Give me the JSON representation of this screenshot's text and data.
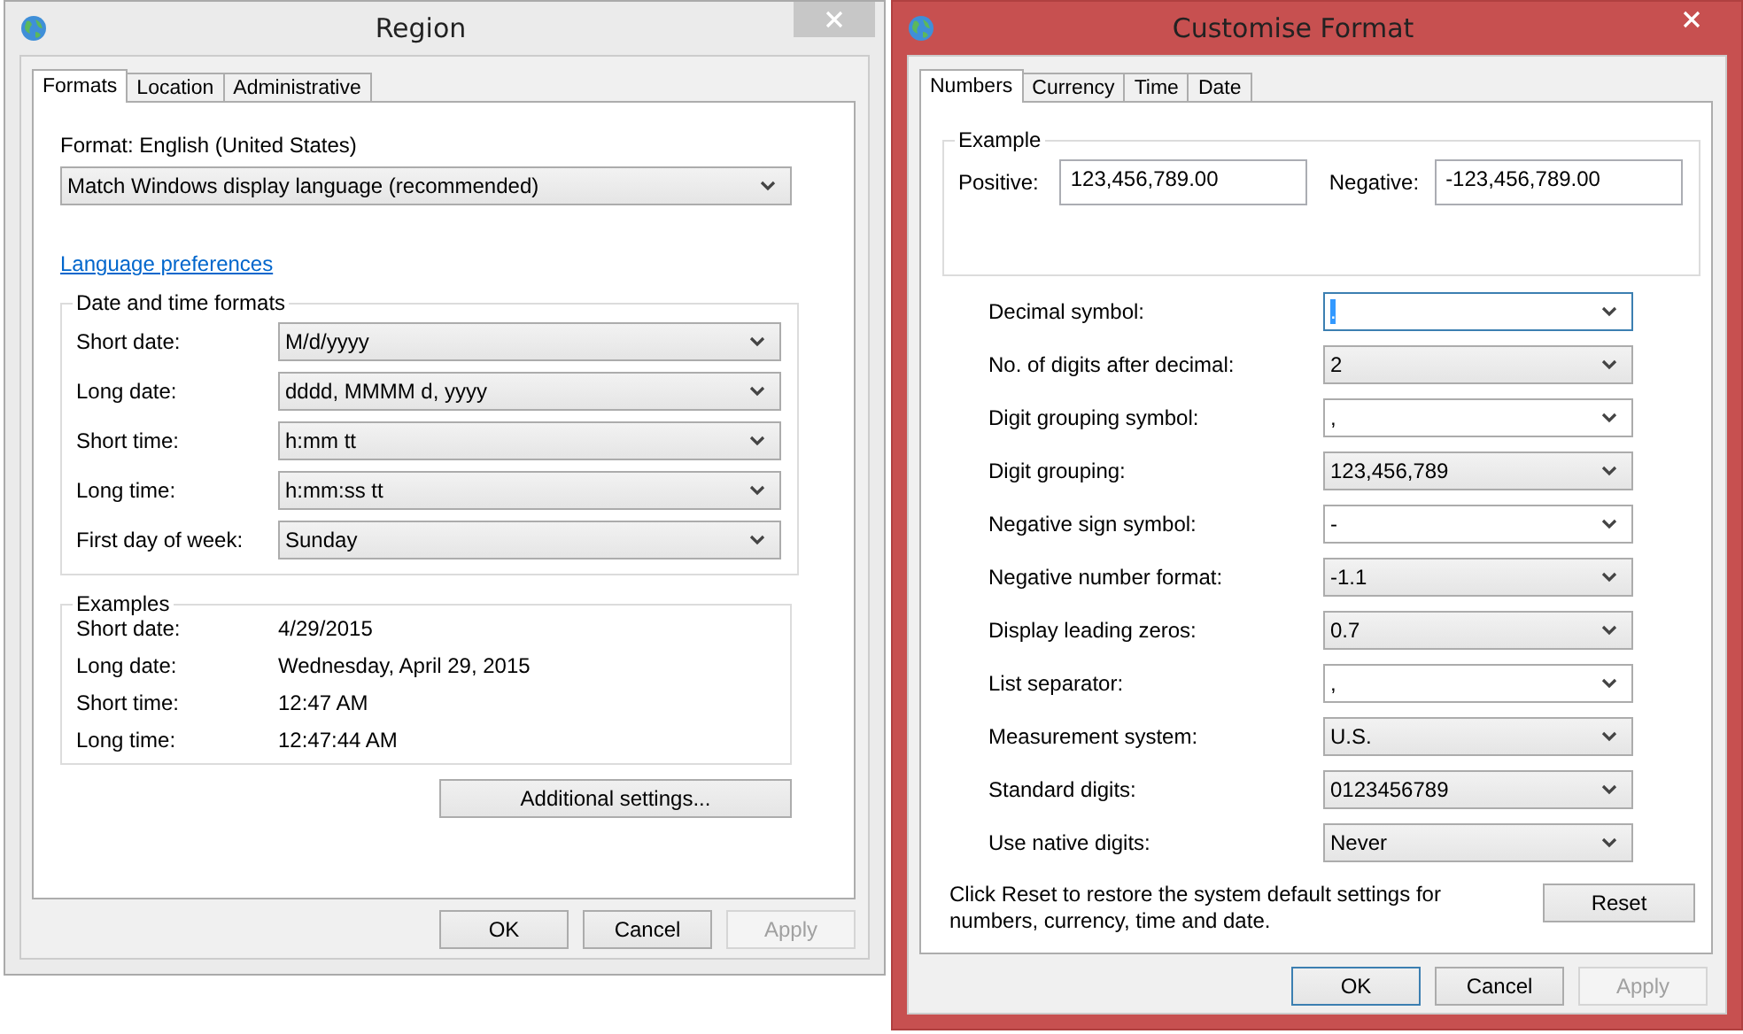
{
  "region": {
    "title": "Region",
    "active": false,
    "tabs": [
      {
        "label": "Formats",
        "selected": true
      },
      {
        "label": "Location",
        "selected": false
      },
      {
        "label": "Administrative",
        "selected": false
      }
    ],
    "format_label": "Format: English (United States)",
    "display_language": "Match Windows display language (recommended)",
    "language_link": "Language preferences",
    "date_time_formats": {
      "title": "Date and time formats",
      "rows": [
        {
          "label": "Short date:",
          "value": "M/d/yyyy"
        },
        {
          "label": "Long date:",
          "value": "dddd, MMMM d, yyyy"
        },
        {
          "label": "Short time:",
          "value": "h:mm tt"
        },
        {
          "label": "Long time:",
          "value": "h:mm:ss tt"
        },
        {
          "label": "First day of week:",
          "value": "Sunday"
        }
      ]
    },
    "examples": {
      "title": "Examples",
      "rows": [
        {
          "label": "Short date:",
          "value": "4/29/2015"
        },
        {
          "label": "Long date:",
          "value": "Wednesday, April 29, 2015"
        },
        {
          "label": "Short time:",
          "value": "12:47 AM"
        },
        {
          "label": "Long time:",
          "value": "12:47:44 AM"
        }
      ]
    },
    "additional_button": "Additional settings...",
    "buttons": [
      {
        "label": "OK",
        "disabled": false
      },
      {
        "label": "Cancel",
        "disabled": false
      },
      {
        "label": "Apply",
        "disabled": true
      }
    ]
  },
  "customise": {
    "title": "Customise Format",
    "active": true,
    "tabs": [
      {
        "label": "Numbers",
        "selected": true
      },
      {
        "label": "Currency",
        "selected": false
      },
      {
        "label": "Time",
        "selected": false
      },
      {
        "label": "Date",
        "selected": false
      }
    ],
    "example": {
      "title": "Example",
      "positive_label": "Positive:",
      "positive_value": "123,456,789.00",
      "negative_label": "Negative:",
      "negative_value": "-123,456,789.00"
    },
    "settings": [
      {
        "label": "Decimal symbol:",
        "value": ".",
        "kind": "combo",
        "focused": true
      },
      {
        "label": "No. of digits after decimal:",
        "value": "2",
        "kind": "list",
        "focused": false
      },
      {
        "label": "Digit grouping symbol:",
        "value": ",",
        "kind": "combo",
        "focused": false
      },
      {
        "label": "Digit grouping:",
        "value": "123,456,789",
        "kind": "list",
        "focused": false
      },
      {
        "label": "Negative sign symbol:",
        "value": "-",
        "kind": "combo",
        "focused": false
      },
      {
        "label": "Negative number format:",
        "value": "-1.1",
        "kind": "list",
        "focused": false
      },
      {
        "label": "Display leading zeros:",
        "value": "0.7",
        "kind": "list",
        "focused": false
      },
      {
        "label": "List separator:",
        "value": ",",
        "kind": "combo",
        "focused": false
      },
      {
        "label": "Measurement system:",
        "value": "U.S.",
        "kind": "list",
        "focused": false
      },
      {
        "label": "Standard digits:",
        "value": "0123456789",
        "kind": "list",
        "focused": false
      },
      {
        "label": "Use native digits:",
        "value": "Never",
        "kind": "list",
        "focused": false
      }
    ],
    "reset_note": "Click Reset to restore the system default settings for numbers, currency, time and date.",
    "reset_button": "Reset",
    "buttons": [
      {
        "label": "OK",
        "disabled": false,
        "default": true
      },
      {
        "label": "Cancel",
        "disabled": false,
        "default": false
      },
      {
        "label": "Apply",
        "disabled": true,
        "default": false
      }
    ]
  }
}
